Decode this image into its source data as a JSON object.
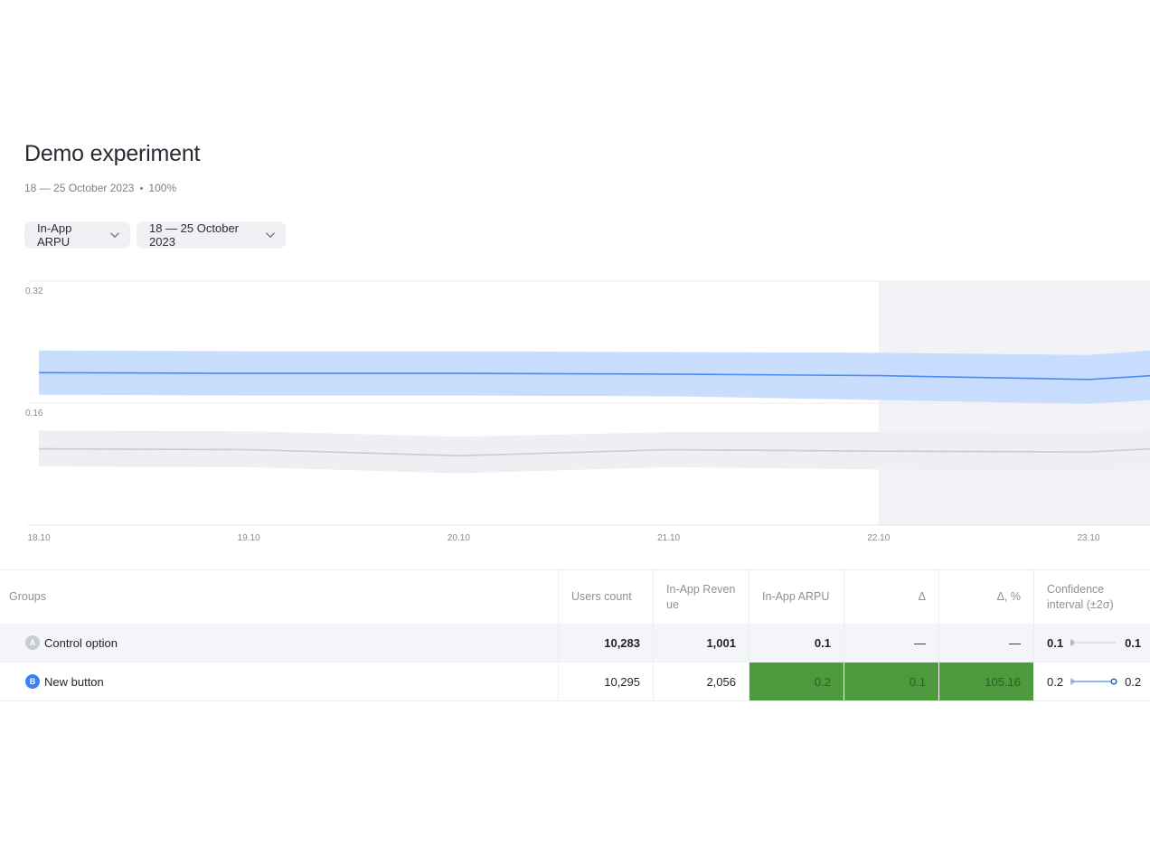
{
  "page": {
    "title": "Demo experiment",
    "date_range": "18 — 25 October 2023",
    "traffic": "100%"
  },
  "filters": {
    "metric": "In-App ARPU",
    "period": "18 — 25 October 2023",
    "chevron_icon": "chevron-down-icon"
  },
  "chart_data": {
    "type": "line",
    "x": [
      "18.10",
      "19.10",
      "20.10",
      "21.10",
      "22.10",
      "23.10"
    ],
    "x_tick_labels": [
      "18.10",
      "19.10",
      "20.10",
      "21.10",
      "22.10",
      "23.10"
    ],
    "y_tick_labels": [
      "0.32",
      "0.16"
    ],
    "ylim": [
      0,
      0.32
    ],
    "grid": true,
    "highlighted_range": [
      "22.10",
      "23.10+"
    ],
    "series": [
      {
        "group": "B",
        "color": "#4a8cf2",
        "band_color": "#c3dafd",
        "x": [
          0,
          1,
          2,
          3,
          4,
          5,
          5.3
        ],
        "values": [
          0.2,
          0.199,
          0.199,
          0.198,
          0.196,
          0.191,
          0.196
        ],
        "upper": [
          0.229,
          0.228,
          0.228,
          0.227,
          0.226,
          0.223,
          0.229
        ],
        "lower": [
          0.171,
          0.17,
          0.17,
          0.169,
          0.164,
          0.159,
          0.164
        ]
      },
      {
        "group": "A",
        "color": "#c8cbd3",
        "band_color": "#eeeff2",
        "x": [
          0,
          1,
          2,
          3,
          4,
          5,
          5.3
        ],
        "values": [
          0.1,
          0.099,
          0.091,
          0.099,
          0.097,
          0.096,
          0.1
        ],
        "upper": [
          0.124,
          0.123,
          0.116,
          0.122,
          0.122,
          0.121,
          0.123
        ],
        "lower": [
          0.077,
          0.076,
          0.068,
          0.076,
          0.073,
          0.072,
          0.074
        ]
      }
    ]
  },
  "table": {
    "headers": {
      "groups": "Groups",
      "users_count": "Users count",
      "revenue": "In-App Reven ue",
      "arpu": "In-App ARPU",
      "delta": "Δ",
      "delta_pct": "Δ, %",
      "ci": "Confidence interval (±2σ)"
    },
    "rows": [
      {
        "badge": "A",
        "name": "Control option",
        "users_count": "10,283",
        "revenue": "1,001",
        "arpu": "0.1",
        "delta": "—",
        "delta_pct": "—",
        "ci_low": "0.1",
        "ci_high": "0.1"
      },
      {
        "badge": "B",
        "name": "New button",
        "users_count": "10,295",
        "revenue": "2,056",
        "arpu": "0.2",
        "delta": "0.1",
        "delta_pct": "105.16",
        "ci_low": "0.2",
        "ci_high": "0.2",
        "highlight_color": "#4c9a3c"
      }
    ]
  }
}
